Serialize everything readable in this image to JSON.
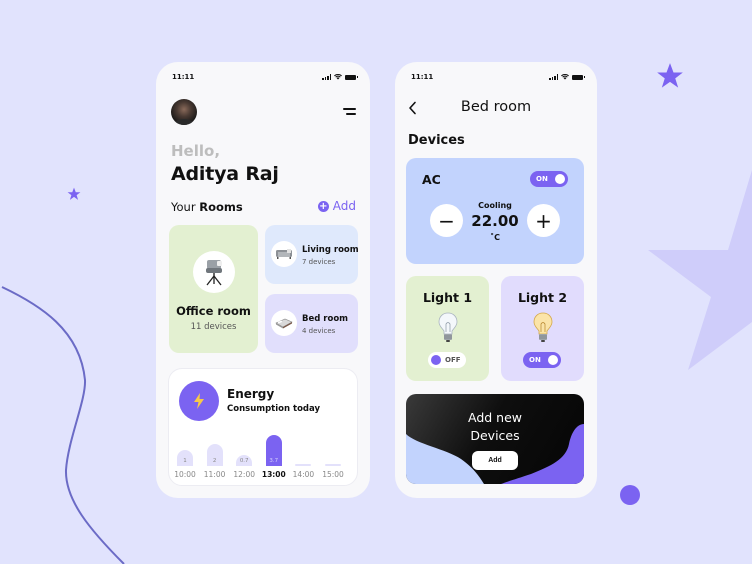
{
  "colors": {
    "background": "#e1e3fd",
    "accent": "#7b63f1",
    "office_card": "#e3f0d1",
    "living_card": "#dfe9fc",
    "bedroom_card": "#e1dffc",
    "ac_card": "#c2d3fd",
    "light2_card": "#e1dcfd"
  },
  "home": {
    "status": {
      "time": "11:11",
      "icons": [
        "signal-icon",
        "wifi-icon",
        "battery-icon"
      ]
    },
    "greeting": "Hello,",
    "user_name": "Aditya Raj",
    "rooms_heading_prefix": "Your",
    "rooms_heading_bold": "Rooms",
    "add_label": "Add",
    "rooms": [
      {
        "name": "Office room",
        "devices": "11 devices",
        "icon": "office-chair-icon"
      },
      {
        "name": "Living room",
        "devices": "7 devices",
        "icon": "sofa-icon"
      },
      {
        "name": "Bed room",
        "devices": "4 devices",
        "icon": "bed-icon"
      }
    ],
    "energy": {
      "title": "Energy",
      "subtitle": "Consumption today",
      "icon": "lightning-icon",
      "bars": [
        {
          "time": "10:00",
          "value": 1,
          "label": "1",
          "active": false
        },
        {
          "time": "11:00",
          "value": 2,
          "label": "2",
          "active": false
        },
        {
          "time": "12:00",
          "value": 0.7,
          "label": "0.7",
          "active": false
        },
        {
          "time": "13:00",
          "value": 3.7,
          "label": "3.7",
          "active": true
        },
        {
          "time": "14:00",
          "value": 0,
          "label": "",
          "active": false
        },
        {
          "time": "15:00",
          "value": 0,
          "label": "",
          "active": false
        }
      ]
    }
  },
  "bedroom": {
    "status": {
      "time": "11:11"
    },
    "title": "Bed room",
    "devices_heading": "Devices",
    "ac": {
      "name": "AC",
      "toggle_label": "ON",
      "is_on": true,
      "mode": "Cooling",
      "temperature": "22.00",
      "unit": "˚C",
      "minus_label": "−",
      "plus_label": "+"
    },
    "lights": [
      {
        "name": "Light 1",
        "toggle_label": "OFF",
        "is_on": false
      },
      {
        "name": "Light 2",
        "toggle_label": "ON",
        "is_on": true
      }
    ],
    "add_devices": {
      "title_line1": "Add new",
      "title_line2": "Devices",
      "button_label": "Add"
    }
  }
}
